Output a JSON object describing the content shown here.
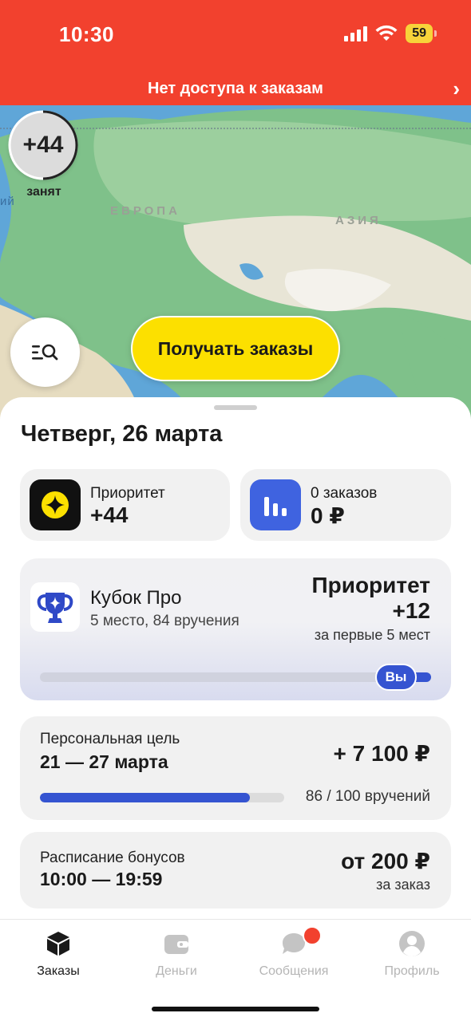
{
  "status_bar": {
    "time": "10:30",
    "battery": "59"
  },
  "alert": {
    "text": "Нет доступа к заказам",
    "chevron": "›"
  },
  "map": {
    "label_europe": "ЕВРОПА",
    "label_asia": "АЗИЯ",
    "label_edge": "ий",
    "priority_value": "+44",
    "status_label": "занят",
    "search_icon": "search-list-icon",
    "get_orders_label": "Получать заказы"
  },
  "sheet": {
    "date": "Четверг, 26 марта",
    "priority_tile": {
      "label": "Приоритет",
      "value": "+44",
      "icon": "priority-icon"
    },
    "orders_tile": {
      "label": "0 заказов",
      "value": "0 ₽",
      "icon": "bar-chart-icon"
    },
    "cup": {
      "title": "Кубок Про",
      "subtitle": "5 место, 84 вручения",
      "priority_label": "Приоритет",
      "priority_value": "+12",
      "note": "за первые 5 мест",
      "you_label": "Вы",
      "icon": "trophy-icon"
    },
    "goal": {
      "title": "Персональная цель",
      "dates": "21 — 27 марта",
      "amount": "+ 7 100 ₽",
      "progress_text": "86 / 100 вручений",
      "progress_current": 86,
      "progress_total": 100
    },
    "bonus": {
      "title": "Расписание бонусов",
      "time": "10:00 — 19:59",
      "amount": "от 200 ₽",
      "note": "за заказ"
    }
  },
  "tabs": [
    {
      "label": "Заказы",
      "icon": "box-icon",
      "active": true
    },
    {
      "label": "Деньги",
      "icon": "wallet-icon",
      "active": false
    },
    {
      "label": "Сообщения",
      "icon": "chat-icon",
      "active": false
    },
    {
      "label": "Профиль",
      "icon": "profile-icon",
      "active": false
    }
  ],
  "colors": {
    "header": "#f2412e",
    "accent_yellow": "#fce000",
    "accent_blue": "#3554d1"
  }
}
